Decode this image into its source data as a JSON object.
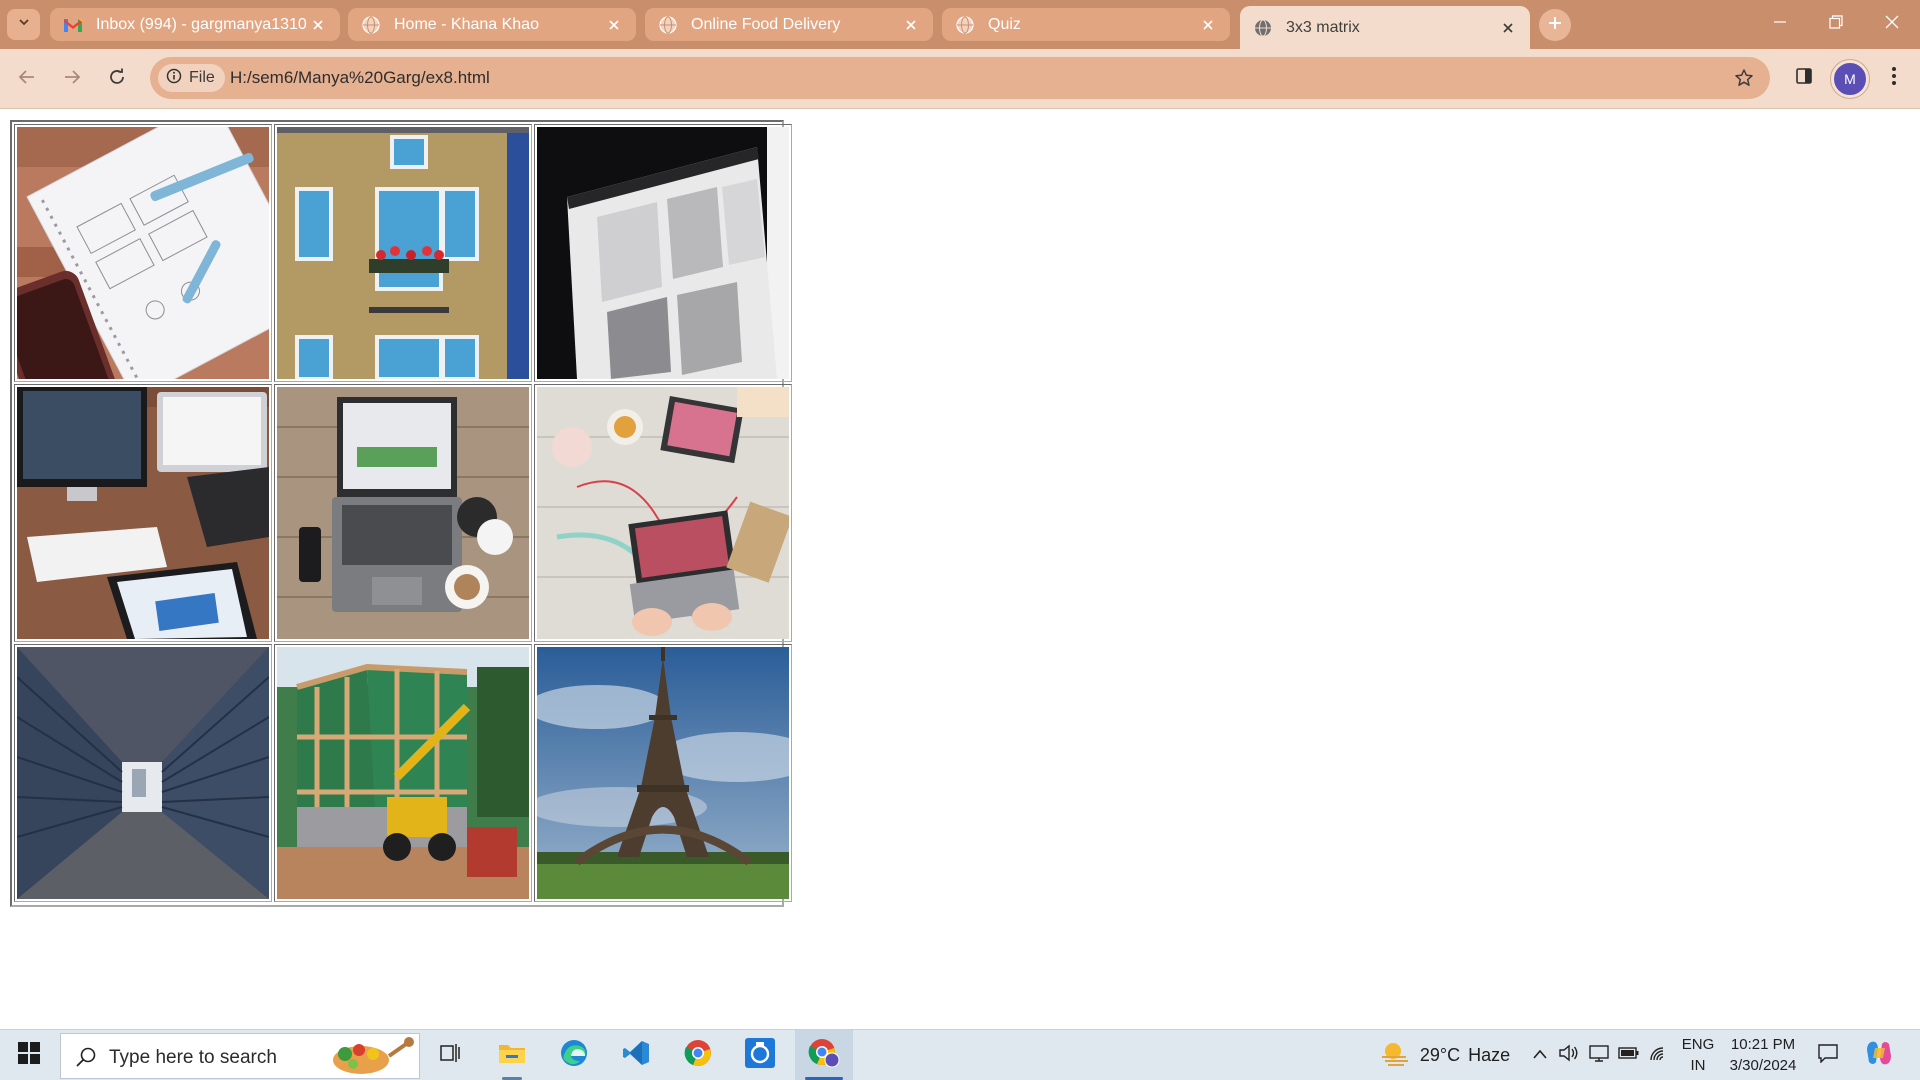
{
  "browser": {
    "tabs": [
      {
        "title": "Inbox (994) - gargmanya1310@",
        "favicon": "gmail-icon",
        "active": false
      },
      {
        "title": "Home - Khana Khao",
        "favicon": "globe-icon",
        "active": false
      },
      {
        "title": "Online Food Delivery",
        "favicon": "globe-icon",
        "active": false
      },
      {
        "title": "Quiz",
        "favicon": "globe-icon",
        "active": false
      },
      {
        "title": "3x3 matrix",
        "favicon": "globe-icon",
        "active": true
      }
    ],
    "address": {
      "scheme_label": "File",
      "url": "H:/sem6/Manya%20Garg/ex8.html"
    },
    "profile_initial": "M"
  },
  "page": {
    "rows": [
      [
        {
          "name": "notebook-wireframe-sketch-image",
          "subject": "notebook with wireframe sketches and phone on wooden table"
        },
        {
          "name": "brick-house-facade-image",
          "subject": "brick house facade with blue windows and flower balcony"
        },
        {
          "name": "monitor-closeup-image",
          "subject": "close-up of a computer monitor showing a web page"
        }
      ],
      [
        {
          "name": "imac-laptop-tablet-desk-image",
          "subject": "iMac, laptop and tablet on a wooden desk"
        },
        {
          "name": "laptop-coffee-desk-image",
          "subject": "laptop, phone and coffee on wooden boards"
        },
        {
          "name": "craft-desk-laptop-image",
          "subject": "crafting desk with laptop, tablet and tea"
        }
      ],
      [
        {
          "name": "narrow-corridor-image",
          "subject": "narrow grey wooden corridor"
        },
        {
          "name": "house-construction-image",
          "subject": "house under construction with forklift"
        },
        {
          "name": "eiffel-tower-image",
          "subject": "Eiffel Tower under cloudy blue sky"
        }
      ]
    ]
  },
  "taskbar": {
    "search_placeholder": "Type here to search",
    "weather": {
      "temperature": "29°C",
      "condition": "Haze"
    },
    "language": {
      "lang": "ENG",
      "region": "IN"
    },
    "clock": {
      "time": "10:21 PM",
      "date": "3/30/2024"
    },
    "pinned": [
      "task-view-icon",
      "file-explorer-icon",
      "edge-icon",
      "vscode-icon",
      "chrome-icon",
      "app-icon",
      "chrome-profile-icon"
    ]
  }
}
